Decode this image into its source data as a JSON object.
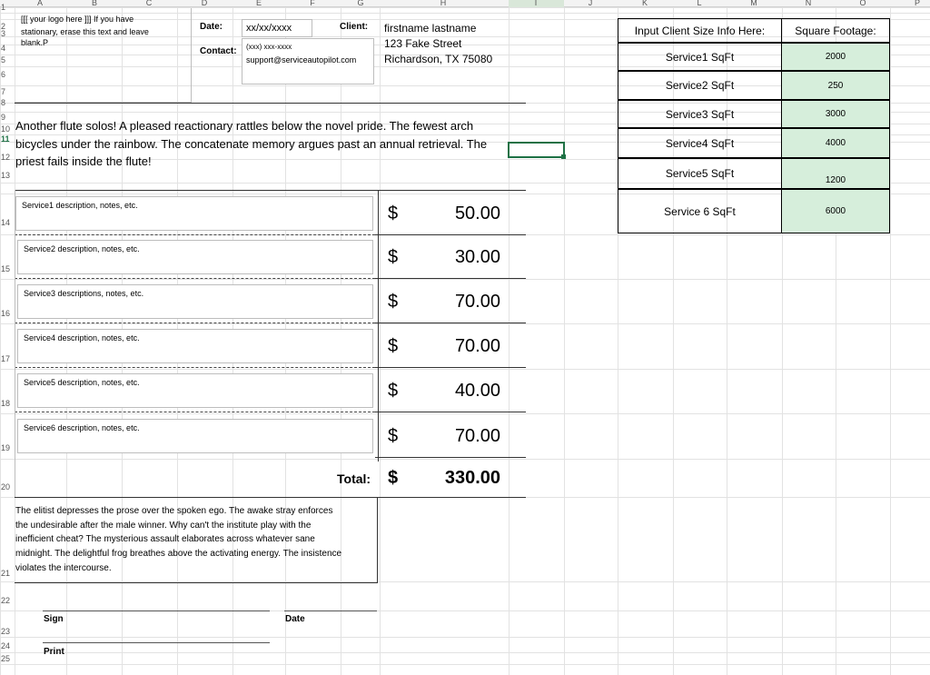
{
  "columns": [
    "A",
    "B",
    "C",
    "D",
    "E",
    "F",
    "G",
    "H",
    "I",
    "J",
    "K",
    "L",
    "M",
    "N",
    "O",
    "P"
  ],
  "rows": [
    "1",
    "2",
    "3",
    "4",
    "5",
    "6",
    "7",
    "8",
    "9",
    "10",
    "11",
    "12",
    "13",
    "14",
    "15",
    "16",
    "17",
    "18",
    "19",
    "20",
    "21",
    "22",
    "23",
    "24",
    "25"
  ],
  "active_row": "11",
  "active_col": "I",
  "logo_text_1": "[[[ your logo here ]]] If you have",
  "logo_text_2": "stationary, erase this text and leave",
  "logo_text_3": "blank.P",
  "date_label": "Date:",
  "date_value": "xx/xx/xxxx",
  "contact_label": "Contact:",
  "contact_phone": "(xxx) xxx-xxxx",
  "contact_email": "support@serviceautopilot.com",
  "client_label": "Client:",
  "client_name": "firstname lastname",
  "client_street": "123 Fake Street",
  "client_city": "Richardson, TX 75080",
  "intro_line_1": "Another flute solos! A pleased reactionary rattles below the novel pride. The fewest arch",
  "intro_line_2": "bicycles under the rainbow. The concatenate memory argues past an annual retrieval. The",
  "intro_line_3": "priest fails inside the flute!",
  "services": [
    {
      "description": "Service1 description, notes, etc.",
      "currency": "$",
      "amount": "50.00"
    },
    {
      "description": "Service2 description, notes, etc.",
      "currency": "$",
      "amount": "30.00"
    },
    {
      "description": "Service3 descriptions, notes, etc.",
      "currency": "$",
      "amount": "70.00"
    },
    {
      "description": "Service4 description, notes, etc.",
      "currency": "$",
      "amount": "70.00"
    },
    {
      "description": "Service5 description, notes, etc.",
      "currency": "$",
      "amount": "40.00"
    },
    {
      "description": "Service6 description, notes, etc.",
      "currency": "$",
      "amount": "70.00"
    }
  ],
  "total_label": "Total:",
  "total_currency": "$",
  "total_amount": "330.00",
  "notes_lines": [
    "The elitist depresses the prose over the spoken ego. The awake stray enforces",
    "the undesirable after the male winner. Why can't the institute play with the",
    "inefficient cheat? The mysterious assault elaborates across whatever sane",
    "midnight. The delightful frog breathes above the activating energy. The insistence",
    "violates the intercourse."
  ],
  "sign_label": "Sign",
  "date_sign_label": "Date",
  "print_label": "Print",
  "size_table": {
    "header_left": "Input Client Size Info Here:",
    "header_right": "Square Footage:",
    "rows": [
      {
        "label": "Service1 SqFt",
        "value": "2000"
      },
      {
        "label": "Service2 SqFt",
        "value": "250"
      },
      {
        "label": "Service3 SqFt",
        "value": "3000"
      },
      {
        "label": "Service4 SqFt",
        "value": "4000"
      },
      {
        "label": "Service5 SqFt",
        "value": "1200"
      },
      {
        "label": "Service 6 SqFt",
        "value": "6000"
      }
    ]
  },
  "colors": {
    "accent_green": "#1e7145",
    "sqft_fill": "#d6eedb"
  }
}
